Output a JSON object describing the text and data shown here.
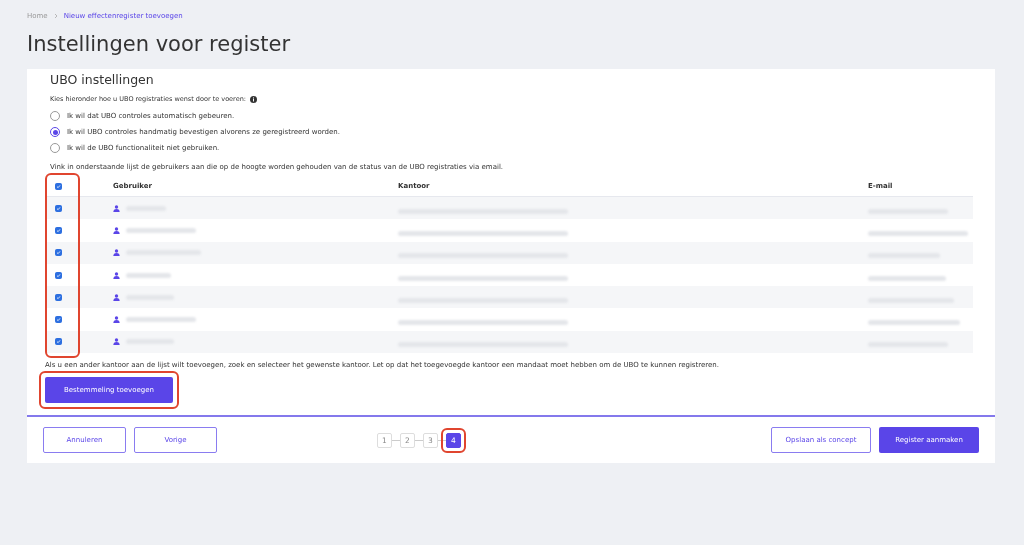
{
  "breadcrumb": [
    {
      "label": "Home",
      "current": false
    },
    {
      "label": "Nieuw effectenregister toevoegen",
      "current": true
    }
  ],
  "title": "Instellingen voor register",
  "section": {
    "title": "UBO instellingen",
    "intro": "Kies hieronder hoe u UBO registraties wenst door te voeren:",
    "options": [
      {
        "label": "Ik wil dat UBO controles automatisch gebeuren.",
        "selected": false
      },
      {
        "label": "Ik wil UBO controles handmatig bevestigen alvorens ze geregistreerd worden.",
        "selected": true
      },
      {
        "label": "Ik wil de UBO functionaliteit niet gebruiken.",
        "selected": false
      }
    ],
    "list_intro": "Vink in onderstaande lijst de gebruikers aan die op de hoogte worden gehouden van de status van de UBO registraties via email."
  },
  "table": {
    "all_checked": true,
    "checkbox_column_highlighted": true,
    "columns": [
      "Gebruiker",
      "Kantoor",
      "E-mail"
    ],
    "rows": [
      {
        "checked": true
      },
      {
        "checked": true
      },
      {
        "checked": true
      },
      {
        "checked": true
      },
      {
        "checked": true
      },
      {
        "checked": true
      },
      {
        "checked": true
      }
    ]
  },
  "note": "Als u een ander kantoor aan de lijst wilt toevoegen, zoek en selecteer het gewenste kantoor. Let op dat het toegevoegde kantoor een mandaat moet hebben om de UBO te kunnen registreren.",
  "add_button": {
    "label": "Bestemmeling toevoegen",
    "highlighted": true
  },
  "footer": {
    "left_buttons": [
      "Annuleren",
      "Vorige"
    ],
    "steps": [
      {
        "label": "1",
        "selected": false,
        "highlighted": false
      },
      {
        "label": "2",
        "selected": false,
        "highlighted": false
      },
      {
        "label": "3",
        "selected": false,
        "highlighted": false
      },
      {
        "label": "4",
        "selected": true,
        "highlighted": true
      }
    ],
    "secondary_button": "Opslaan als concept",
    "primary_button": "Register aanmaken"
  }
}
